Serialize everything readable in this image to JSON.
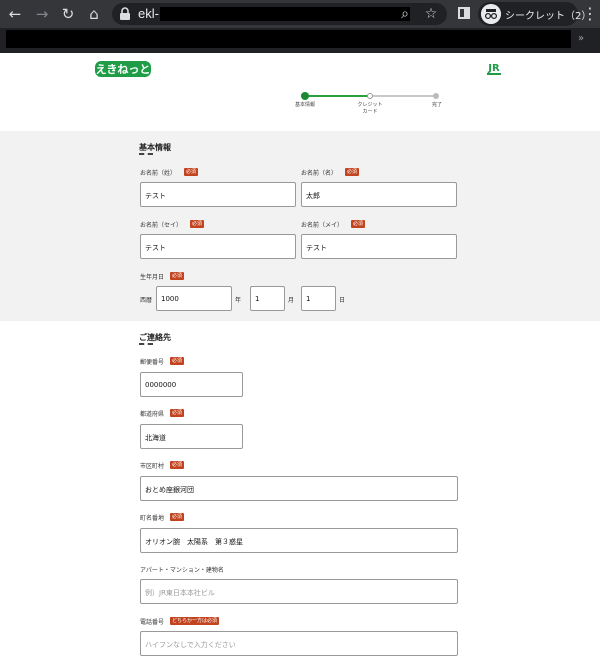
{
  "browser": {
    "url": "ekl-",
    "incognito_label": "シークレット（2）",
    "icons": [
      "back-icon",
      "forward-icon",
      "reload-icon",
      "home-icon",
      "lock-icon",
      "zoom-icon",
      "star-icon",
      "side-panel-icon",
      "incognito-icon",
      "menu-icon"
    ]
  },
  "header": {
    "logo_text": "えきねっと",
    "jr_logo_text": "JR",
    "steps": [
      {
        "label": "基本情報",
        "state": "active"
      },
      {
        "label": "クレジット\nカード",
        "state": "pending"
      },
      {
        "label": "完了",
        "state": "pending"
      }
    ]
  },
  "colors": {
    "accent_green": "#2aa141",
    "required_badge": "#c2441f",
    "section_bg": "#f2f2f2"
  },
  "basic_info": {
    "title": "基本情報",
    "required": "必須",
    "last_name": {
      "label": "お名前（姓）",
      "value": "テスト"
    },
    "first_name": {
      "label": "お名前（名）",
      "value": "太郎"
    },
    "last_kana": {
      "label": "お名前（セイ）",
      "value": "テスト"
    },
    "first_kana": {
      "label": "お名前（メイ）",
      "value": "テスト"
    },
    "birthdate": {
      "label": "生年月日",
      "era": "西暦",
      "year": "1000",
      "year_unit": "年",
      "month": "1",
      "month_unit": "月",
      "day": "1",
      "day_unit": "日"
    }
  },
  "contact": {
    "title": "ご連絡先",
    "required": "必須",
    "postal": {
      "label": "郵便番号",
      "value": "0000000"
    },
    "prefecture": {
      "label": "都道府県",
      "value": "北海道"
    },
    "city": {
      "label": "市区町村",
      "value": "おとめ座銀河団"
    },
    "street": {
      "label": "町名番地",
      "value": "オリオン腕　太陽系　第３惑星"
    },
    "building": {
      "label": "アパート・マンション・建物名",
      "placeholder": "例）JR東日本本社ビル"
    },
    "phone": {
      "label": "電話番号",
      "badge": "どちらか一方は必須",
      "placeholder": "ハイフンなしで入力ください"
    }
  }
}
